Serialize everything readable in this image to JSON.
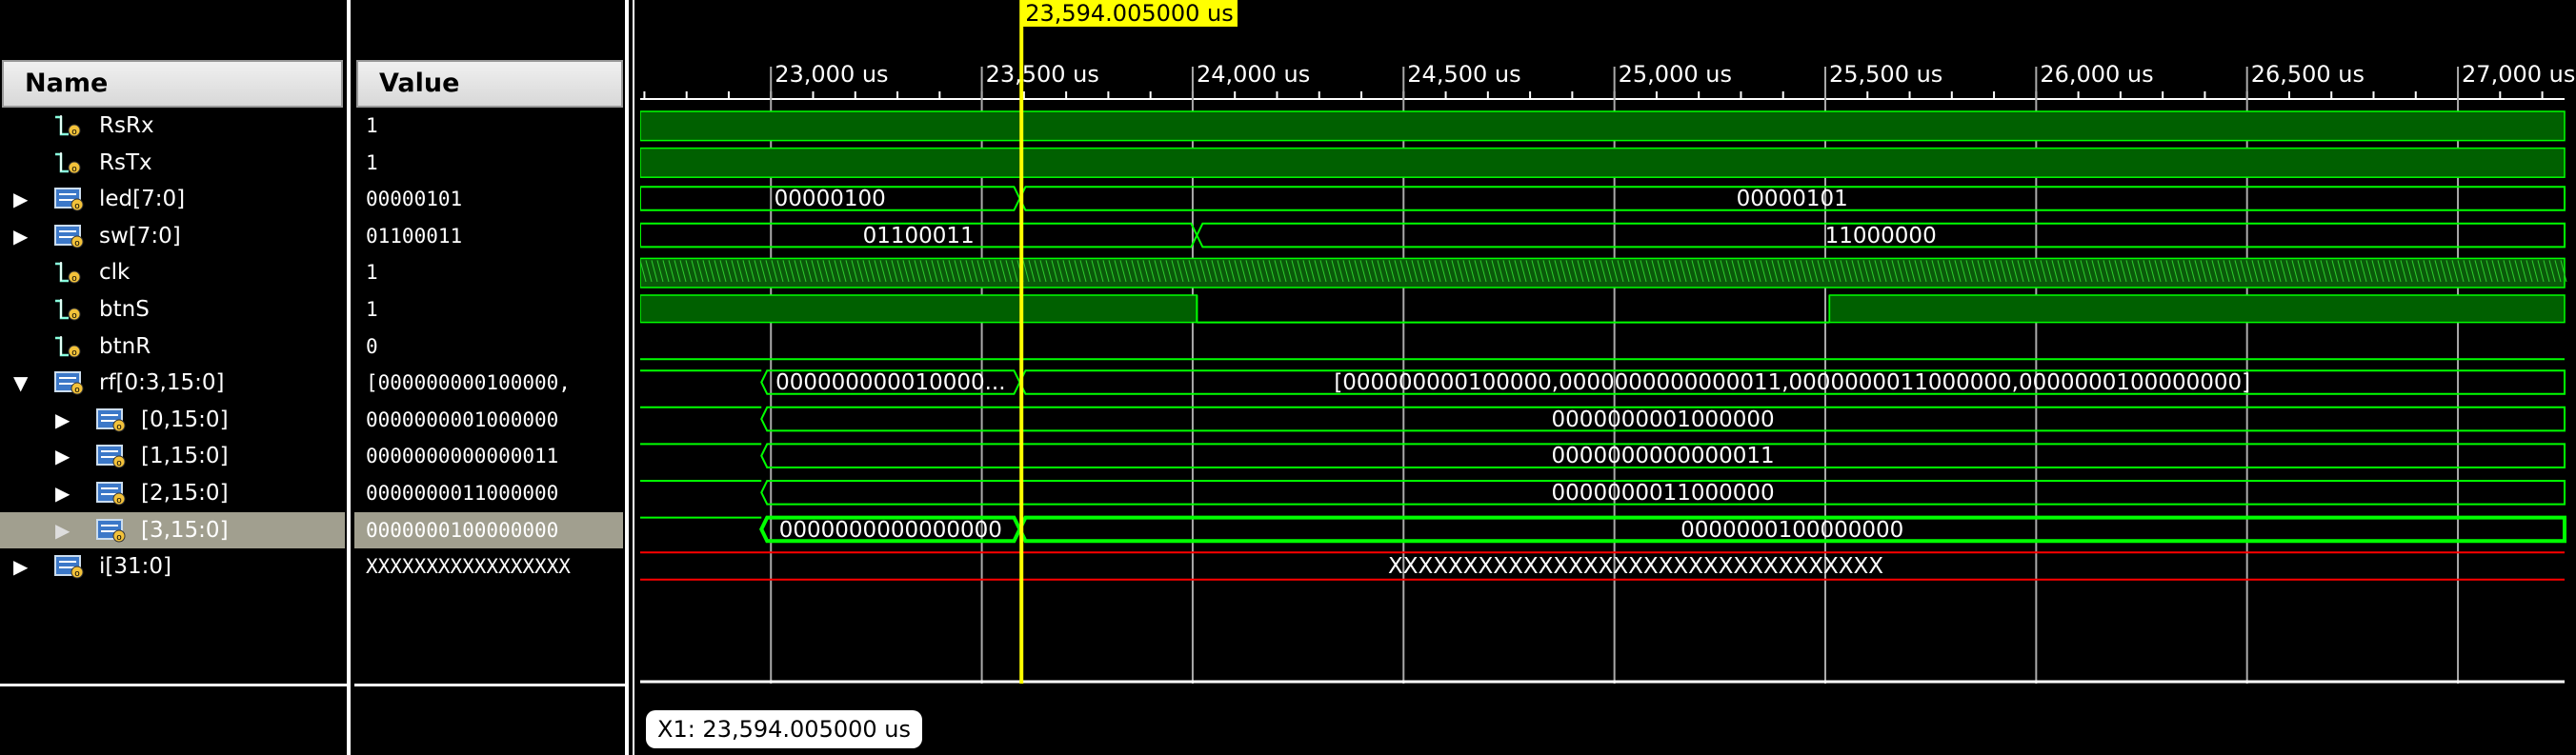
{
  "headers": {
    "name": "Name",
    "value": "Value"
  },
  "signals": [
    {
      "name": "RsRx",
      "value": "1",
      "expand": "none",
      "indent": 0,
      "icon": "wire-icon"
    },
    {
      "name": "RsTx",
      "value": "1",
      "expand": "none",
      "indent": 0,
      "icon": "wire-icon"
    },
    {
      "name": "led[7:0]",
      "value": "00000101",
      "expand": "collapsed",
      "indent": 0,
      "icon": "bus-icon"
    },
    {
      "name": "sw[7:0]",
      "value": "01100011",
      "expand": "collapsed",
      "indent": 0,
      "icon": "bus-icon"
    },
    {
      "name": "clk",
      "value": "1",
      "expand": "none",
      "indent": 0,
      "icon": "wire-icon"
    },
    {
      "name": "btnS",
      "value": "1",
      "expand": "none",
      "indent": 0,
      "icon": "wire-icon"
    },
    {
      "name": "btnR",
      "value": "0",
      "expand": "none",
      "indent": 0,
      "icon": "wire-icon"
    },
    {
      "name": "rf[0:3,15:0]",
      "value": "[000000000100000,",
      "expand": "expanded",
      "indent": 0,
      "icon": "bus-icon"
    },
    {
      "name": "[0,15:0]",
      "value": "0000000001000000",
      "expand": "collapsed",
      "indent": 1,
      "icon": "bus-icon"
    },
    {
      "name": "[1,15:0]",
      "value": "0000000000000011",
      "expand": "collapsed",
      "indent": 1,
      "icon": "bus-icon"
    },
    {
      "name": "[2,15:0]",
      "value": "0000000011000000",
      "expand": "collapsed",
      "indent": 1,
      "icon": "bus-icon"
    },
    {
      "name": "[3,15:0]",
      "value": "0000000100000000",
      "expand": "collapsed",
      "indent": 1,
      "icon": "bus-icon",
      "selected": true
    },
    {
      "name": "i[31:0]",
      "value": "XXXXXXXXXXXXXXXXX",
      "expand": "collapsed",
      "indent": 0,
      "icon": "bus-icon"
    }
  ],
  "ruler": {
    "unit": "us",
    "start": 22690,
    "end": 27280,
    "major_ticks": [
      "23,000 us",
      "23,500 us",
      "24,000 us",
      "24,500 us",
      "25,000 us",
      "25,500 us",
      "26,000 us",
      "26,500 us",
      "27,000 us"
    ],
    "major_values": [
      23000,
      23500,
      24000,
      24500,
      25000,
      25500,
      26000,
      26500,
      27000
    ]
  },
  "cursor": {
    "time": 23594.005,
    "label": "23,594.005000 us"
  },
  "marker_label": "X1: 23,594.005000 us",
  "waves": {
    "led_values": [
      "00000100",
      "00000101"
    ],
    "sw_values": [
      "01100011",
      "11000000"
    ],
    "rf_values": [
      "000000000010000...",
      "[000000000100000,0000000000000011,0000000011000000,0000000100000000]"
    ],
    "rf0_value": "0000000001000000",
    "rf1_value": "0000000000000011",
    "rf2_value": "0000000011000000",
    "rf3_values": [
      "0000000000000000",
      "0000000100000000"
    ],
    "i_value": "XXXXXXXXXXXXXXXXXXXXXXXXXXXXXXXXX",
    "transitions": {
      "led": 23590,
      "sw": 24010,
      "btnS_low": 24010,
      "btnS_high": 25510,
      "rf_start": 23000
    }
  },
  "colors": {
    "wave": "#00ff00",
    "wave_fill": "#006000",
    "cursor": "#ffff00",
    "undefined": "#ff0000",
    "selected_row": "#a19f8f"
  }
}
